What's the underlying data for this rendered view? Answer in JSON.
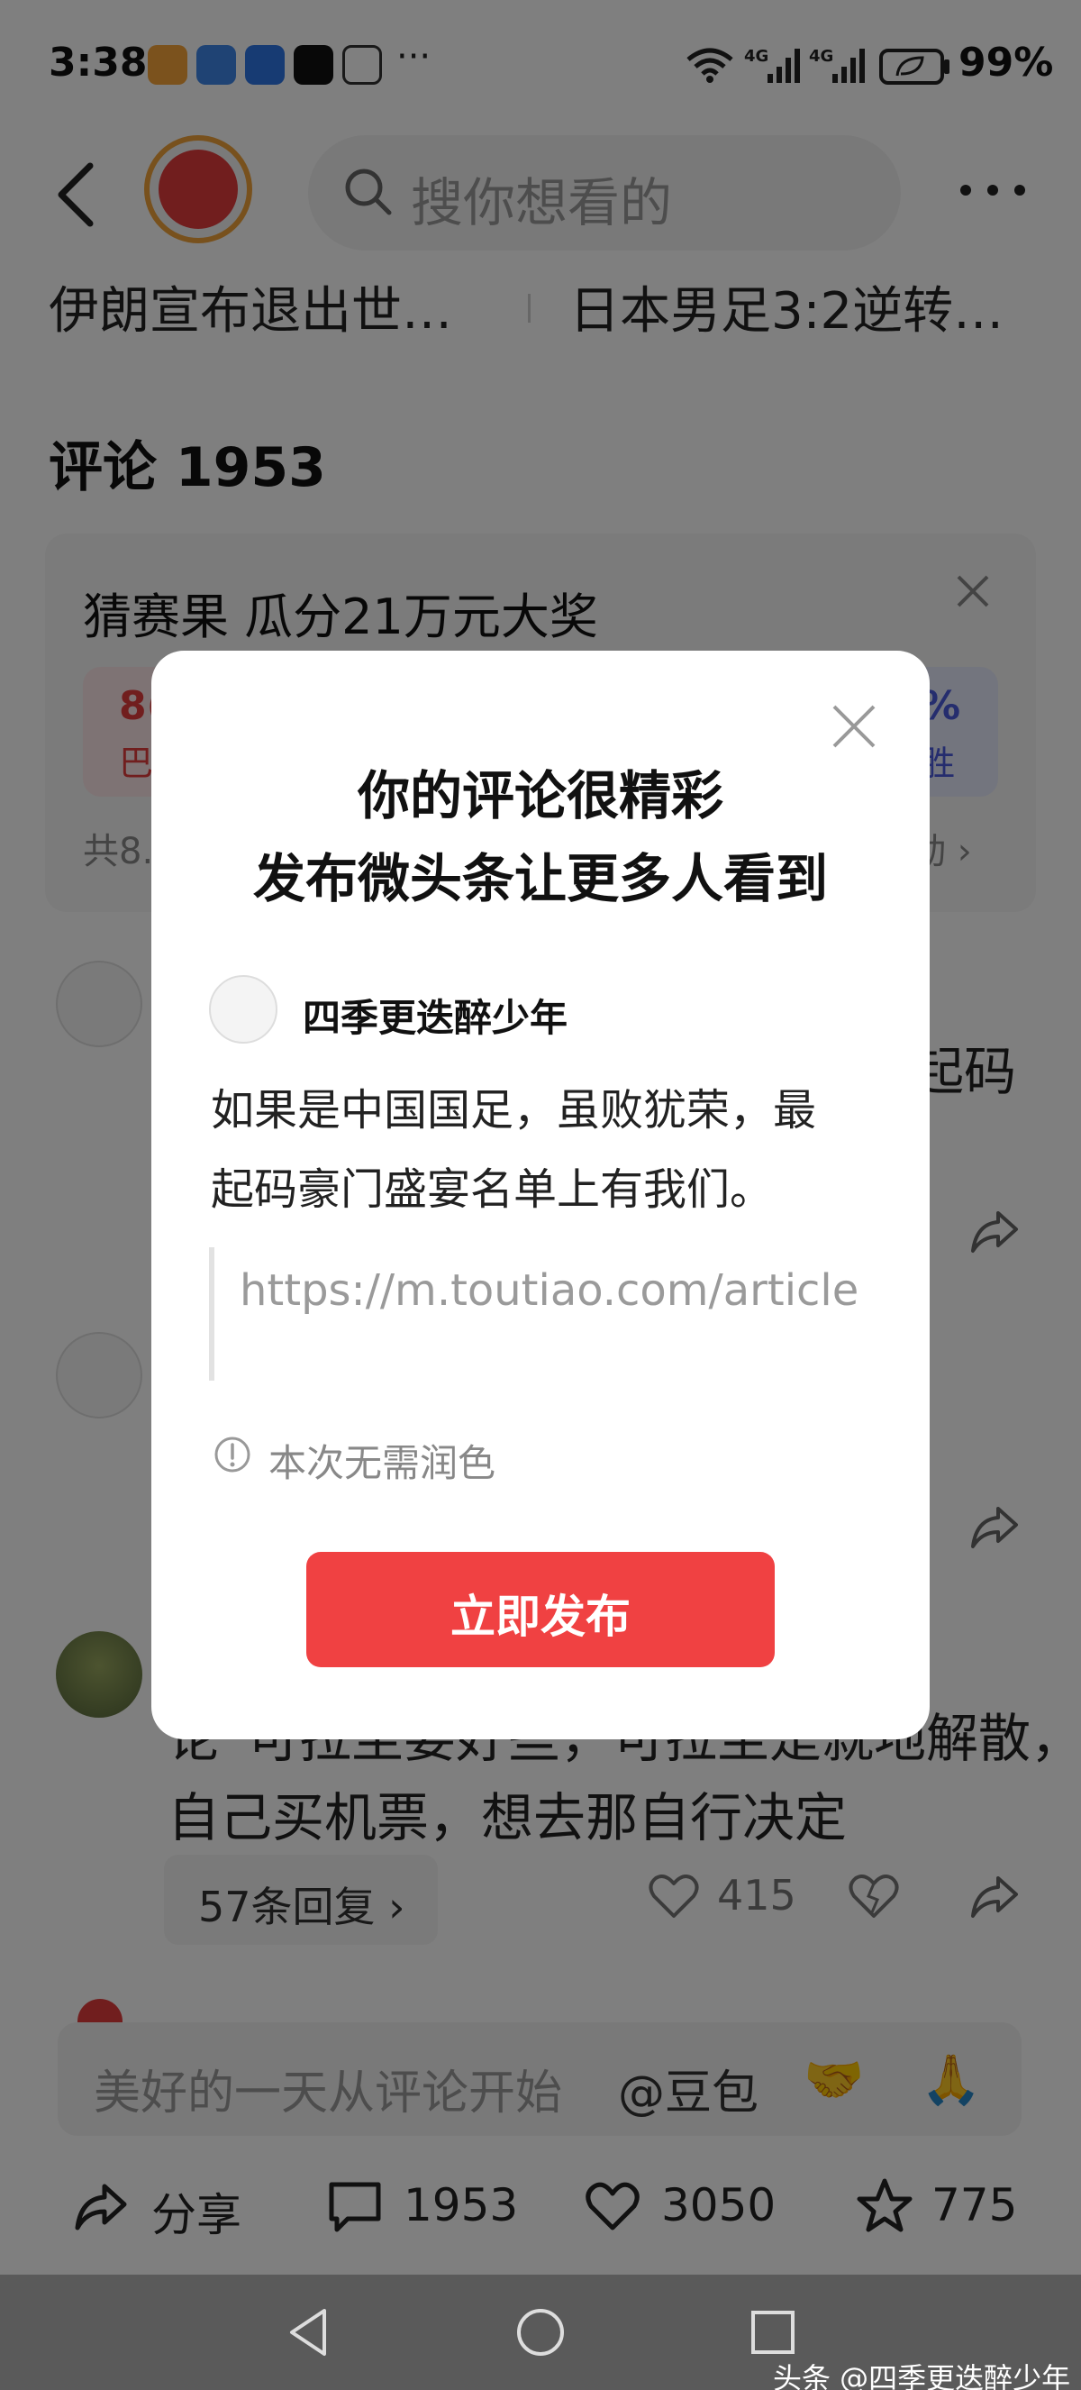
{
  "status_bar": {
    "time": "3:38",
    "dots": "···",
    "battery": "99%",
    "icons": [
      "heart-app-icon",
      "card-app-icon",
      "browser-app-icon",
      "tiktok-icon",
      "hand-icon",
      "wifi-icon",
      "4g-signal-icon",
      "4g-signal-icon",
      "battery-icon"
    ]
  },
  "header": {
    "search_placeholder": "搜你想看的",
    "back_icon": "back-arrow-icon",
    "more_icon": "more-dots-icon"
  },
  "news": {
    "left": "伊朗宣布退出世…",
    "right": "日本男足3:2逆转…"
  },
  "comments_section": {
    "title": "评论 1953"
  },
  "guess_card": {
    "title": "猜赛果 瓜分21万元大奖",
    "left_pct": "8(",
    "left_label": "巴",
    "right_pct": "%",
    "right_label": "胜",
    "total": "共8.",
    "link": "动 ›"
  },
  "comments": {
    "fragment_1": "起码",
    "c3_line1": "论“可拉至要好些，可拉至是就地解散，",
    "c3_line2": "自己买机票，想去那自行决定",
    "replies": "57条回复 ›",
    "likes": "415"
  },
  "input_bar": {
    "placeholder": "美好的一天从评论开始",
    "mention": "@豆包",
    "emoji_1": "🤝",
    "emoji_2": "🙏"
  },
  "actions": {
    "share": "分享",
    "comments": "1953",
    "likes": "3050",
    "favorites": "775"
  },
  "modal": {
    "title_line1": "你的评论很精彩",
    "title_line2": "发布微头条让更多人看到",
    "username": "四季更迭醉少年",
    "comment_line1": "如果是中国国足，虽败犹荣，最",
    "comment_line2": "起码豪门盛宴名单上有我们。",
    "link": "https://m.toutiao.com/article",
    "hint": "本次无需润色",
    "publish": "立即发布"
  },
  "watermark": "头条 @四季更迭醉少年",
  "colors": {
    "accent_red": "#f04142",
    "overlay": "rgba(0,0,0,0.5)"
  }
}
